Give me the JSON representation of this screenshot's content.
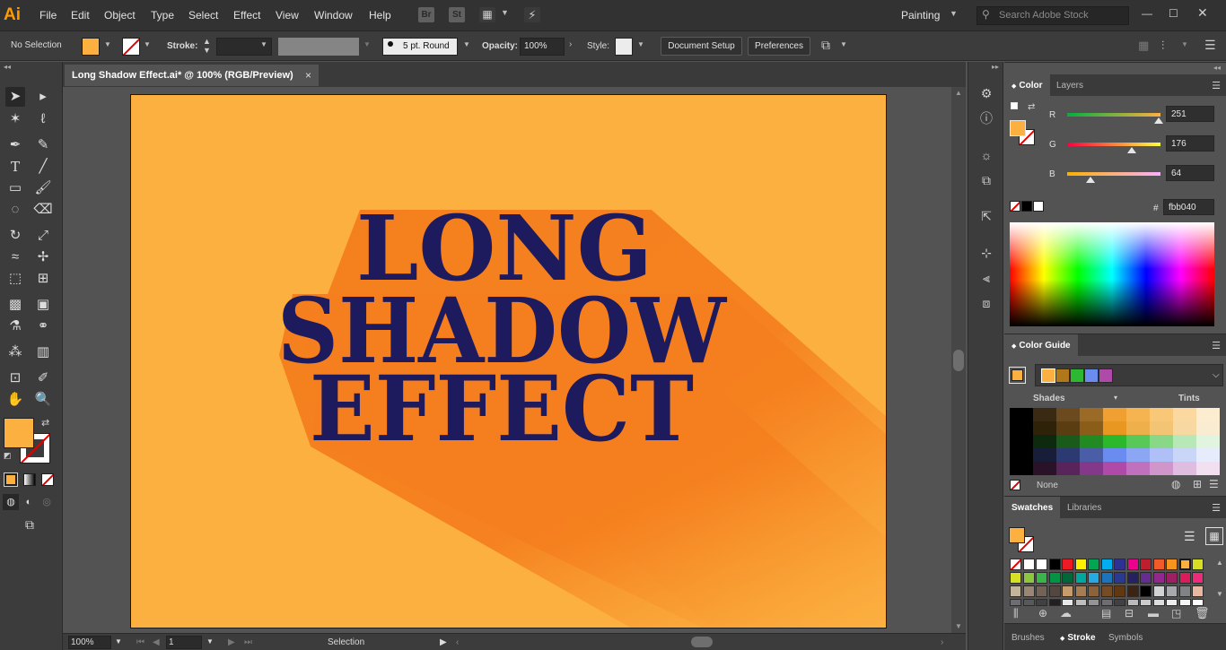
{
  "app": {
    "logo": "Ai",
    "menu": [
      "File",
      "Edit",
      "Object",
      "Type",
      "Select",
      "Effect",
      "View",
      "Window",
      "Help"
    ],
    "bridge_icon": "Br",
    "stock_icon": "St",
    "workspace": "Painting",
    "search_placeholder": "Search Adobe Stock"
  },
  "control_bar": {
    "selection_status": "No Selection",
    "stroke_label": "Stroke:",
    "brush": "5 pt. Round",
    "opacity_label": "Opacity:",
    "opacity_value": "100%",
    "style_label": "Style:",
    "document_setup": "Document Setup",
    "preferences": "Preferences"
  },
  "document": {
    "tab_title": "Long Shadow Effect.ai* @ 100% (RGB/Preview)",
    "close_glyph": "×",
    "art_lines": [
      "LONG",
      "SHADOW",
      "EFFECT"
    ],
    "artboard_color": "#fbb040",
    "text_color": "#1d1a5e",
    "shadow_color": "#f57f1e"
  },
  "status_bar": {
    "zoom": "100%",
    "page": "1",
    "tool": "Selection"
  },
  "color_panel": {
    "tabs": [
      "Color",
      "Layers"
    ],
    "r_label": "R",
    "g_label": "G",
    "b_label": "B",
    "r": "251",
    "g": "176",
    "b": "64",
    "r_frac": 0.984,
    "g_frac": 0.69,
    "b_frac": 0.251,
    "hash_label": "#",
    "hex": "fbb040",
    "fill_color": "#fbb040"
  },
  "color_guide": {
    "tab": "Color Guide",
    "shades_label": "Shades",
    "tints_label": "Tints",
    "none_label": "None"
  },
  "swatches": {
    "tabs": [
      "Swatches",
      "Libraries"
    ]
  },
  "bottom_tabs": [
    "Brushes",
    "Stroke",
    "Symbols"
  ]
}
